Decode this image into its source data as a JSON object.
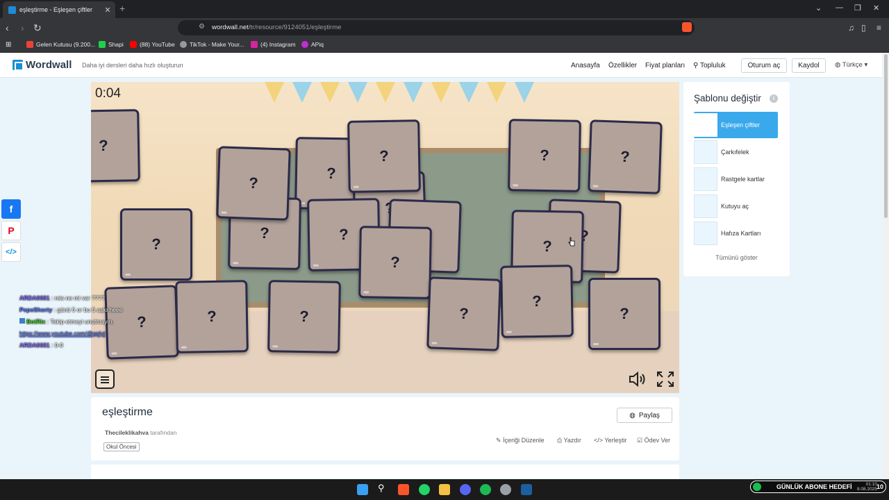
{
  "browser": {
    "tab_title": "eşleştirme - Eşleşen çiftler",
    "tab_close": "✕",
    "new_tab": "+",
    "url_host": "wordwall.net",
    "url_path": "/tr/resource/9124051/eşleştirme",
    "bookmarks": [
      "Gelen Kutusu (9.200...",
      "Shapi",
      "(88) YouTube",
      "TikTok - Make Your...",
      "(4) Instagram",
      "APiq"
    ]
  },
  "header": {
    "logo": "Wordwall",
    "tagline": "Daha iyi dersleri daha hızlı oluşturun",
    "nav": [
      "Anasayfa",
      "Özellikler",
      "Fiyat planları",
      "Topluluk"
    ],
    "login": "Oturum aç",
    "register": "Kaydol",
    "language": "Türkçe"
  },
  "game": {
    "timer": "0:04",
    "card_symbol": "?"
  },
  "chat": [
    {
      "user": "ARDA0681",
      "text": ": reis ne mi var ????"
    },
    {
      "user": "PepeShorty",
      "text": ": günü 5 or bu 5 aşkı heee"
    },
    {
      "user": "BotRix",
      "text": ": Takip etmeyi unutmayın."
    },
    {
      "user": "",
      "text": "https://www.youtube.com/@gplyt"
    },
    {
      "user": "ARDA0681",
      "text": ": 0-0"
    }
  ],
  "panel": {
    "title": "Şablonu değiştir",
    "templates": [
      "Eşleşen çiftler",
      "Çarkıfelek",
      "Rastgele kartlar",
      "Kutuyu aç",
      "Hafıza Kartları"
    ],
    "show_all": "Tümünü göster"
  },
  "activity": {
    "title": "eşleştirme",
    "author": "Thecileklikahva",
    "author_suffix": " tarafından",
    "tag": "Okul Öncesi",
    "share": "Paylaş",
    "actions": [
      "İçeriği Düzenle",
      "Yazdır",
      "Yerleştir",
      "Ödev Ver"
    ]
  },
  "taskbar": {
    "widget_text": "GÜNLÜK ABONE HEDEFİ",
    "widget_count": "10",
    "time": "01:10",
    "date": "8.08.2025"
  }
}
